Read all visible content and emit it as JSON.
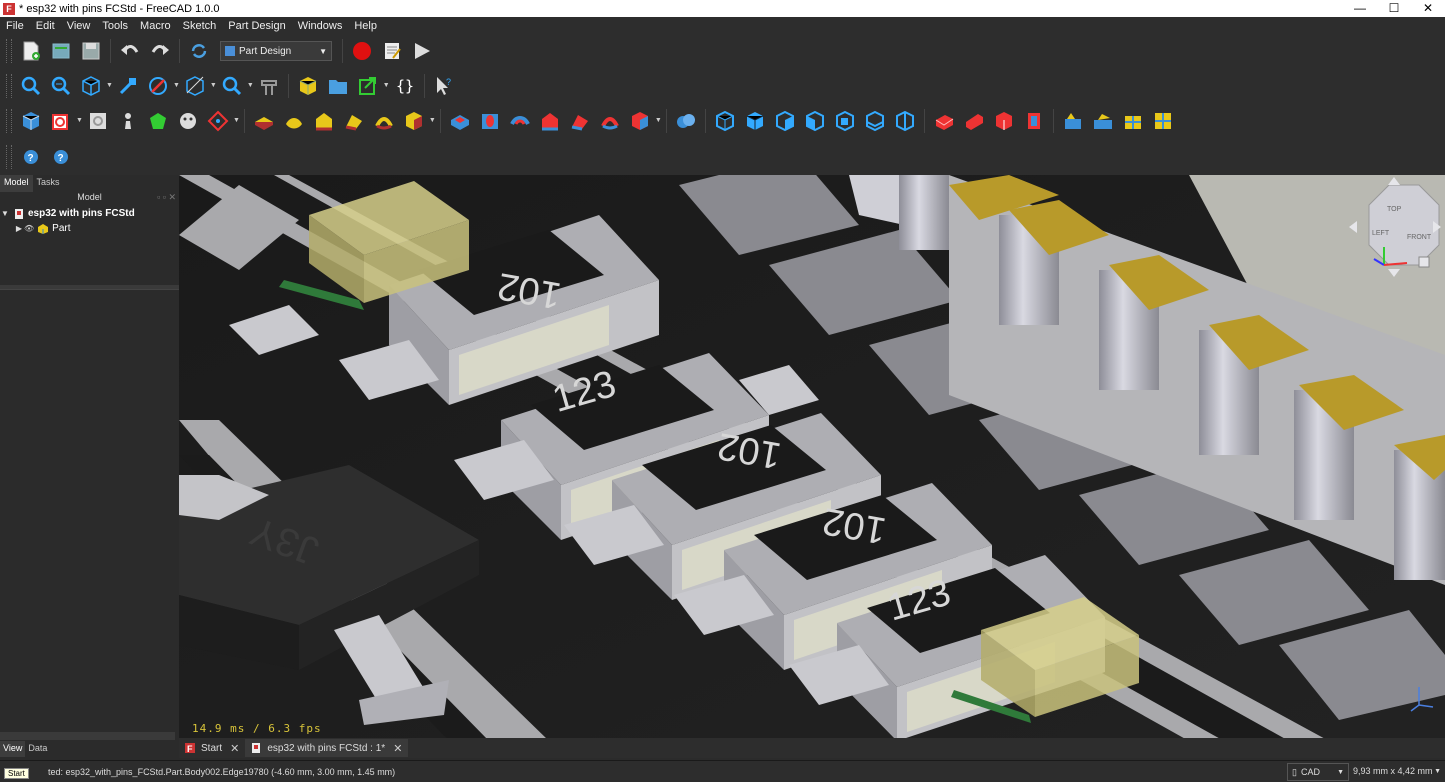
{
  "window": {
    "title": "* esp32 with pins FCStd - FreeCAD 1.0.0",
    "app_icon": "F"
  },
  "window_controls": {
    "minimize": "—",
    "maximize": "☐",
    "close": "✕"
  },
  "menu": [
    "File",
    "Edit",
    "View",
    "Tools",
    "Macro",
    "Sketch",
    "Part Design",
    "Windows",
    "Help"
  ],
  "workbench_selector": {
    "value": "Part Design"
  },
  "left_panel": {
    "tabs": [
      "Model",
      "Tasks"
    ],
    "title": "Model",
    "tree": [
      {
        "label": "esp32 with pins FCStd",
        "level": 0
      },
      {
        "label": "Part",
        "level": 1
      }
    ],
    "bottom_tabs": [
      "View",
      "Data"
    ]
  },
  "doc_tabs": [
    {
      "label": "Start"
    },
    {
      "label": "esp32 with pins FCStd : 1*"
    }
  ],
  "viewport": {
    "fps": "14.9 ms / 6.3 fps",
    "resistor_labels": [
      "102",
      "123",
      "102",
      "102",
      "123"
    ],
    "chip_label": "J3Y"
  },
  "navcube": {
    "top": "TOP",
    "front": "FRONT",
    "left": "LEFT"
  },
  "statusbar": {
    "message": "ted: esp32_with_pins_FCStd.Part.Body002.Edge19780 (-4.60 mm, 3.00 mm, 1.45 mm)",
    "tooltip": "Start",
    "nav_style": "CAD",
    "dimensions": "9,93 mm x 4,42 mm"
  },
  "colors": {
    "accent_gold": "#b89a2a",
    "pcb": "#1b1b1b",
    "pad": "#8a8a90",
    "silk": "#a7a7a7"
  }
}
